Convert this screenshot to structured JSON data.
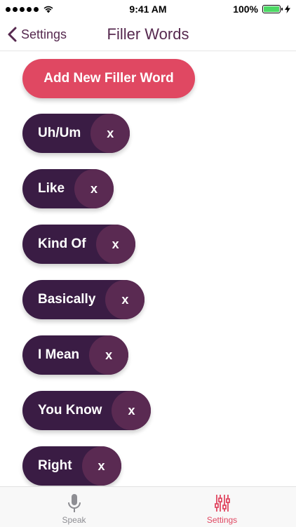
{
  "status_bar": {
    "time": "9:41 AM",
    "battery_percent": "100%",
    "signal_icon": "signal-dots-icon",
    "wifi_icon": "wifi-icon",
    "battery_icon": "battery-icon",
    "charging_icon": "bolt-icon"
  },
  "nav": {
    "back_label": "Settings",
    "title": "Filler Words"
  },
  "add_button_label": "Add New Filler Word",
  "filler_words": [
    {
      "label": "Uh/Um",
      "remove": "x"
    },
    {
      "label": "Like",
      "remove": "x"
    },
    {
      "label": "Kind Of",
      "remove": "x"
    },
    {
      "label": "Basically",
      "remove": "x"
    },
    {
      "label": "I Mean",
      "remove": "x"
    },
    {
      "label": "You Know",
      "remove": "x"
    },
    {
      "label": "Right",
      "remove": "x"
    }
  ],
  "tab_bar": {
    "tabs": [
      {
        "label": "Speak",
        "icon": "microphone-icon",
        "active": false
      },
      {
        "label": "Settings",
        "icon": "sliders-icon",
        "active": true
      }
    ]
  },
  "colors": {
    "accent": "#e04862",
    "pill": "#3a1c44",
    "pill_remove": "#5a2a52",
    "nav_text": "#56294f"
  }
}
